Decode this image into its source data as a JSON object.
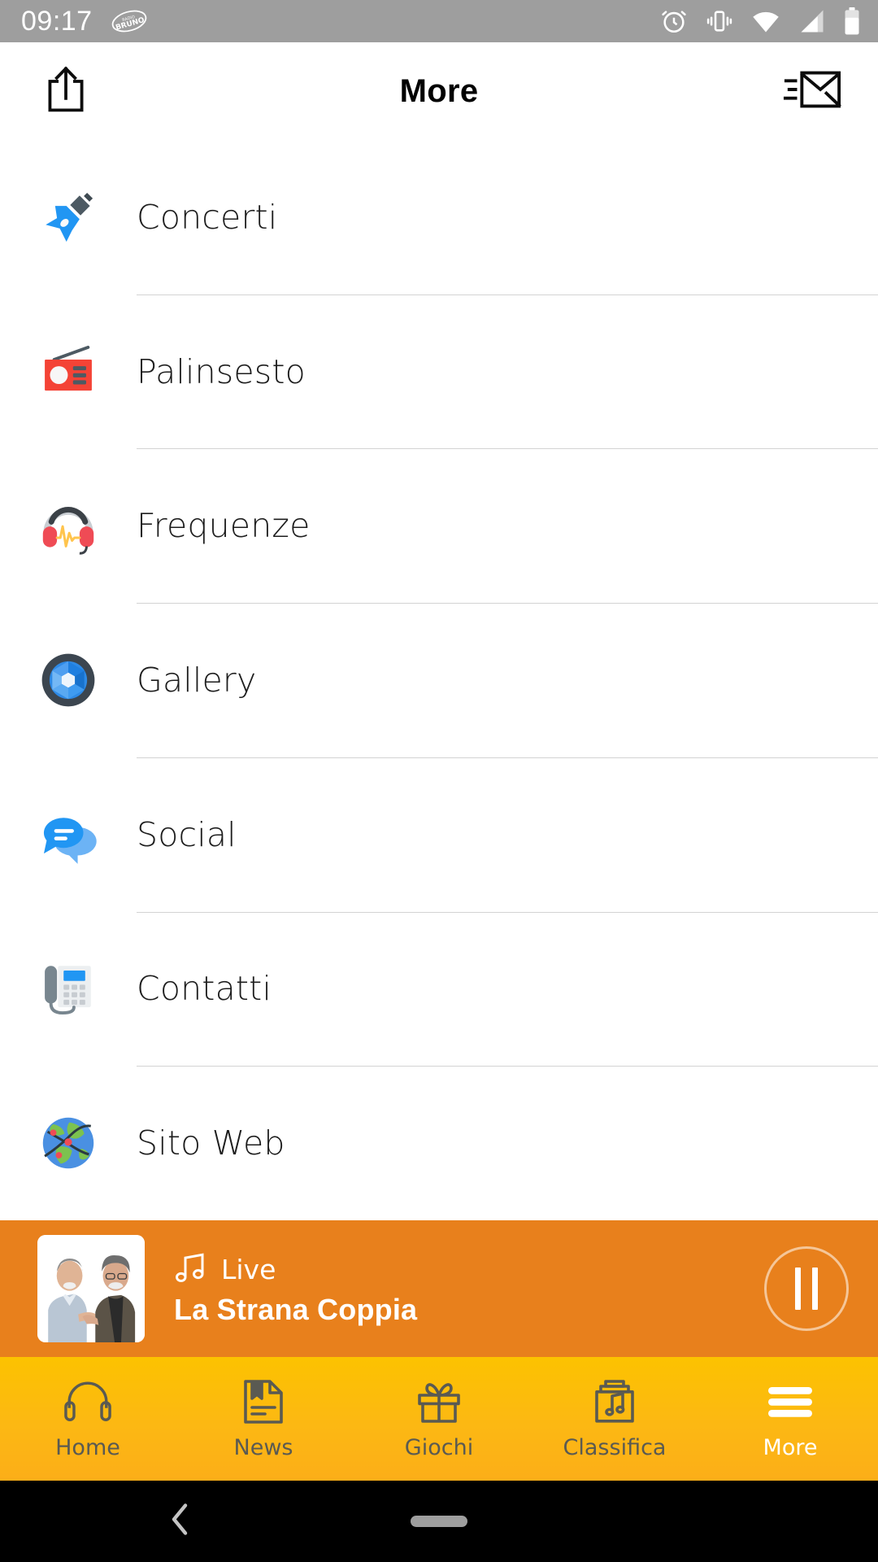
{
  "status_bar": {
    "time": "09:17",
    "app_badge": "radio-bruno-logo",
    "icons": [
      "alarm-icon",
      "vibrate-icon",
      "wifi-icon",
      "cellular-signal-icon",
      "battery-icon"
    ],
    "background_color": "#9e9e9e"
  },
  "header": {
    "title": "More",
    "left_action": "share-icon",
    "right_action": "mail-icon"
  },
  "menu": {
    "items": [
      {
        "label": "Concerti",
        "icon": "guitar-icon"
      },
      {
        "label": "Palinsesto",
        "icon": "radio-icon"
      },
      {
        "label": "Frequenze",
        "icon": "headphones-waveform-icon"
      },
      {
        "label": "Gallery",
        "icon": "camera-aperture-icon"
      },
      {
        "label": "Social",
        "icon": "chat-bubbles-icon"
      },
      {
        "label": "Contatti",
        "icon": "telephone-icon"
      },
      {
        "label": "Sito Web",
        "icon": "globe-network-icon"
      }
    ]
  },
  "player": {
    "status_label": "Live",
    "status_icon": "music-note-icon",
    "track_title": "La Strana Coppia",
    "artwork": "two-hosts-photo",
    "transport_button": "pause-button",
    "background_color": "#e8801c"
  },
  "bottom_nav": {
    "items": [
      {
        "label": "Home",
        "icon": "headphones-icon",
        "active": false
      },
      {
        "label": "News",
        "icon": "news-document-icon",
        "active": false
      },
      {
        "label": "Giochi",
        "icon": "gift-icon",
        "active": false
      },
      {
        "label": "Classifica",
        "icon": "music-chart-icon",
        "active": false
      },
      {
        "label": "More",
        "icon": "hamburger-menu-icon",
        "active": true
      }
    ],
    "background_color": "#fcb813"
  },
  "system_nav": {
    "back": "back-chevron-icon",
    "home": "home-pill-indicator"
  }
}
